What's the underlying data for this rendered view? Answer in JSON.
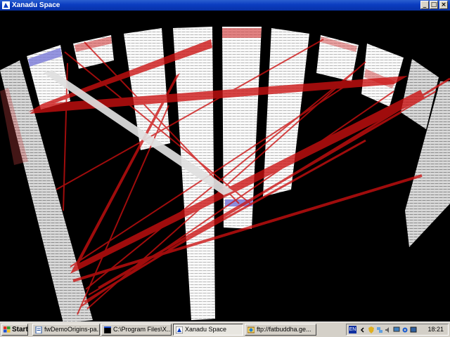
{
  "window": {
    "title": "Xanadu Space",
    "buttons": {
      "minimize": "_",
      "maximize": "□",
      "close": "×"
    }
  },
  "colors": {
    "titlebar": "#0a3cc0",
    "link_red": "#cc1010",
    "link_white": "#e0e0e0",
    "highlight_blue": "#7070d0",
    "page": "#ffffff",
    "background": "#000000"
  },
  "scene": {
    "icon_names": [
      "document-page-icon"
    ],
    "document_count": 11,
    "highlighted_documents": [
      "center",
      "upper-left"
    ]
  },
  "taskbar": {
    "start_label": "Start",
    "tasks": [
      {
        "label": "fwDemoOrigins-pa...",
        "icon": "notepad-icon",
        "active": false
      },
      {
        "label": "C:\\Program Files\\X...",
        "icon": "console-icon",
        "active": false
      },
      {
        "label": "Xanadu Space",
        "icon": "xanadu-icon",
        "active": true
      },
      {
        "label": "ftp://fatbuddha.ge...",
        "icon": "explorer-icon",
        "active": false
      }
    ],
    "tray": {
      "language": "EN",
      "icons": [
        "chevron-icon",
        "shield-icon",
        "network-icon",
        "speaker-icon",
        "monitor-icon",
        "gear-icon",
        "display-icon"
      ],
      "clock": "18:21"
    }
  }
}
